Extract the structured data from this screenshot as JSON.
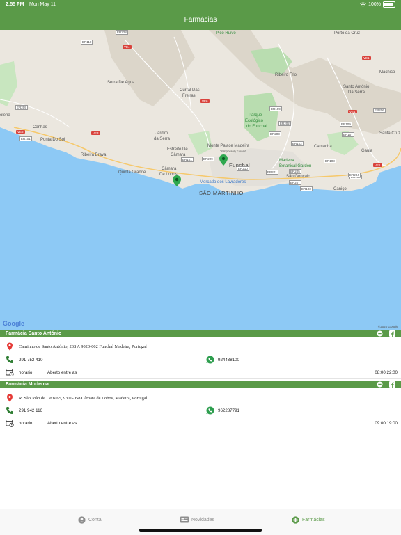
{
  "status": {
    "time": "2:55 PM",
    "date": "Mon May 11",
    "battery": "100%"
  },
  "nav": {
    "title": "Farmácias"
  },
  "map": {
    "labels": {
      "pico_ruivo": "Pico Ruivo",
      "porto_da_cruz": "Porto da Cruz",
      "machico": "Machico",
      "serra_de_agua": "Serra De Agua",
      "curral": "Curral Das",
      "freiras": "Freiras",
      "ribeiro_frio": "Ribeiro Frio",
      "santo_antonio": "Santo António",
      "da_serra": "Da Serra",
      "parque1": "Parque",
      "parque2": "Ecológico",
      "parque3": "do Funchal",
      "canhas": "Canhas",
      "ponta_do_sol": "Ponta Do Sol",
      "jardim1": "Jardim",
      "jardim2": "da Serra",
      "estreito1": "Estreito De",
      "estreito2": "Câmara",
      "monte_palace": "Monte Palace Madeira",
      "monte_sub": "Temporarily closed",
      "funchal": "Funchal",
      "camacha": "Camacha",
      "santa_cruz": "Santa Cruz",
      "ribeira_brava": "Ribeira Brava",
      "quinta_grande": "Quinta Grande",
      "camara1": "Câmara",
      "camara2": "De Lobos",
      "botanical1": "Madeira",
      "botanical2": "Botanical Garden",
      "gaula": "Gaula",
      "mercado": "Mercado dos Lavradores",
      "sao_goncalo": "São Gonçalo",
      "sao_martinho": "SÃO MARTINHO",
      "canico": "Caniço",
      "calheta_edge": "olena",
      "google": "Google",
      "copyright": "©2020 Google"
    },
    "roads": [
      "ER228",
      "ER110",
      "VE4",
      "VE1",
      "ER209",
      "ER101",
      "ER109",
      "ER202",
      "ER206",
      "VE1",
      "ER109",
      "ER203",
      "VE5",
      "ER102",
      "ER107",
      "ER108",
      "ER205",
      "VE6",
      "ER104",
      "ER101",
      "VE3",
      "ER229",
      "ER210",
      "ER201",
      "ER103",
      "ER207",
      "ER204",
      "VE1"
    ]
  },
  "pharmacies": [
    {
      "name": "Farmácia Santo António",
      "address": "Caminho de Santo António, 238 A 9020-002 Funchal Madeira, Portugal",
      "phone": "291 752 410",
      "whatsapp": "924438100",
      "schedule_label": "horario",
      "open_label": "Aberto entre as",
      "hours": "08:00 22:00"
    },
    {
      "name": "Farmácia Moderna",
      "address": "R. São João de Deus 65, 9300-058 Câmara de Lobos, Madeira, Portugal",
      "phone": "291 942 116",
      "whatsapp": "962287791",
      "schedule_label": "horario",
      "open_label": "Aberto entre as",
      "hours": "09:00 19:00"
    }
  ],
  "tabs": [
    {
      "label": "Conta",
      "icon": "person-icon"
    },
    {
      "label": "Novidades",
      "icon": "news-icon"
    },
    {
      "label": "Farmácias",
      "icon": "plus-circle-icon"
    }
  ],
  "colors": {
    "brand": "#5a9a48",
    "sea": "#8dc9f5",
    "land": "#ebe7df",
    "pin": "#2fa84f"
  }
}
